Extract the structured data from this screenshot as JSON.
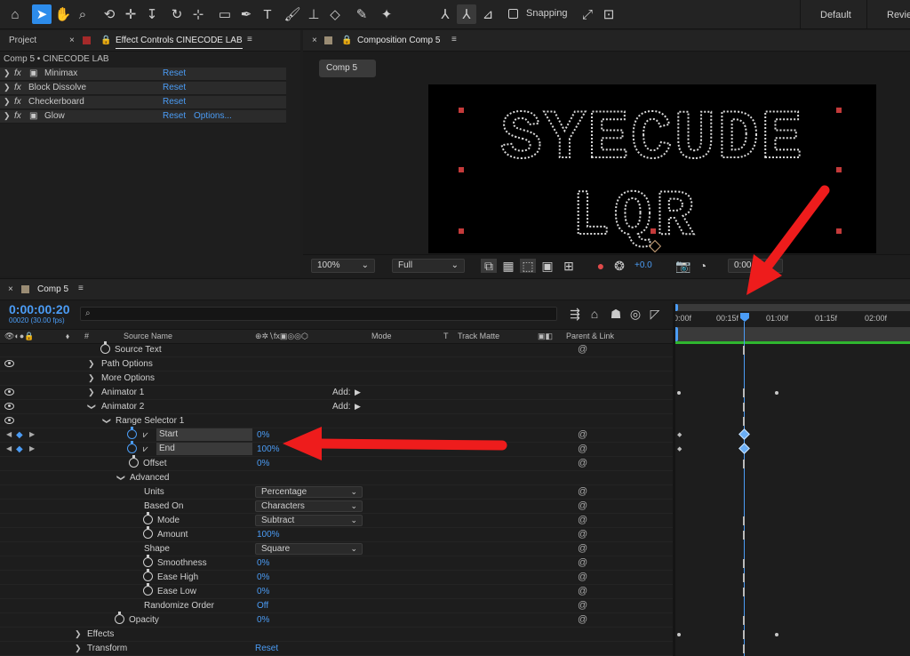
{
  "workspace": {
    "default_label": "Default",
    "review_label": "Revie"
  },
  "toolbar": {
    "snapping_label": "Snapping"
  },
  "project_panel": {
    "project_tab": "Project",
    "effect_controls_tab": "Effect Controls CINECODE LAB",
    "breadcrumb": "Comp 5 • CINECODE LAB",
    "effects": [
      {
        "name": "Minimax",
        "reset": "Reset"
      },
      {
        "name": "Block Dissolve",
        "reset": "Reset"
      },
      {
        "name": "Checkerboard",
        "reset": "Reset"
      },
      {
        "name": "Glow",
        "reset": "Reset",
        "options": "Options..."
      }
    ]
  },
  "composition": {
    "tab": "Composition Comp 5",
    "comp_button": "Comp 5",
    "preview_text": {
      "line1": "SYECUDE",
      "line2": "LQR"
    },
    "zoom": "100%",
    "resolution": "Full",
    "exposure": "+0.0",
    "timecode": "0:00"
  },
  "timeline": {
    "tab": "Comp 5",
    "timecode": "0:00:00:20",
    "frame_info": "00020 (30.00 fps)",
    "search_placeholder": "",
    "ruler": [
      "0:00f",
      "00:15f",
      "01:00f",
      "01:15f",
      "02:00f"
    ],
    "columns": {
      "number": "#",
      "source_name": "Source Name",
      "mode": "Mode",
      "t": "T",
      "track_matte": "Track Matte",
      "parent": "Parent & Link"
    },
    "rows": [
      {
        "label": "Source Text"
      },
      {
        "label": "Path Options"
      },
      {
        "label": "More Options"
      },
      {
        "label": "Animator 1",
        "add": "Add:"
      },
      {
        "label": "Animator 2",
        "add": "Add:"
      },
      {
        "label": "Range Selector 1"
      },
      {
        "label": "Start",
        "value": "0%"
      },
      {
        "label": "End",
        "value": "100%"
      },
      {
        "label": "Offset",
        "value": "0%"
      },
      {
        "label": "Advanced"
      },
      {
        "label": "Units",
        "value": "Percentage"
      },
      {
        "label": "Based On",
        "value": "Characters"
      },
      {
        "label": "Mode",
        "value": "Subtract"
      },
      {
        "label": "Amount",
        "value": "100%"
      },
      {
        "label": "Shape",
        "value": "Square"
      },
      {
        "label": "Smoothness",
        "value": "0%"
      },
      {
        "label": "Ease High",
        "value": "0%"
      },
      {
        "label": "Ease Low",
        "value": "0%"
      },
      {
        "label": "Randomize Order",
        "value": "Off"
      },
      {
        "label": "Opacity",
        "value": "0%"
      },
      {
        "label": "Effects"
      },
      {
        "label": "Transform",
        "value": "Reset"
      }
    ]
  },
  "colors": {
    "accent": "#2d8ceb",
    "value_blue": "#4b9cf5",
    "arrow_red": "#ee1c1c",
    "work_area_green": "#2fb62f"
  }
}
